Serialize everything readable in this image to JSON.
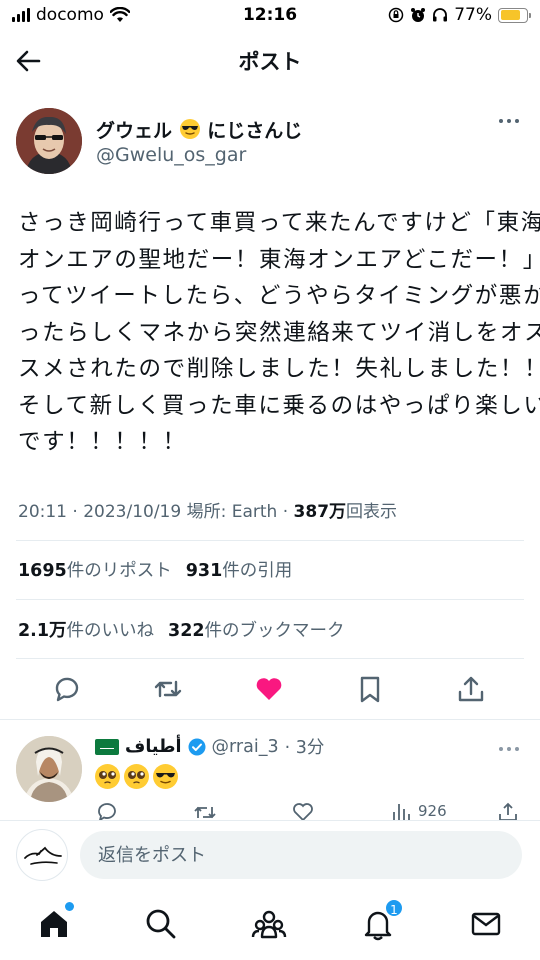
{
  "status_bar": {
    "carrier": "docomo",
    "time": "12:16",
    "battery": "77%",
    "battery_level": 0.77,
    "colors": {
      "battery_fill": "#f7c429"
    }
  },
  "header": {
    "title": "ポスト",
    "back_icon": "arrow-left-icon"
  },
  "tweet": {
    "author_name": "グウェル",
    "author_name_suffix": "にじさんじ",
    "author_handle": "@Gwelu_os_gar",
    "text_lines": [
      "さっき岡崎行って車買って来たんですけど「東海",
      "オンエアの聖地だー！東海オンエアどこだー！」",
      "ってツイートしたら、どうやらタイミングが悪か",
      "ったらしくマネから突然連絡来てツイ消しをオス",
      "スメされたので削除しました！失礼しました！！",
      "そして新しく買った車に乗るのはやっぱり楽しい",
      "です！！！！！"
    ],
    "meta_prefix": "20:11 · 2023/10/19 場所: Earth · ",
    "views_count": "387万",
    "views_label": "回表示",
    "reposts_count": "1695",
    "reposts_label": "件のリポスト",
    "quotes_count": "931",
    "quotes_label": "件の引用",
    "likes_count": "2.1万",
    "likes_label": "件のいいね",
    "bookmarks_count": "322",
    "bookmarks_label": "件のブックマーク",
    "liked": true,
    "colors": {
      "like_active": "#f91880"
    }
  },
  "reply": {
    "name": "أطياف",
    "handle": "@rrai_3",
    "time_ago": "· 3分",
    "emojis": [
      "pleading-face",
      "pleading-face",
      "sunglasses-face"
    ],
    "views": "926"
  },
  "compose": {
    "placeholder": "返信をポスト"
  },
  "tab_bar": {
    "items": [
      "home-icon",
      "search-icon",
      "communities-icon",
      "notifications-icon",
      "messages-icon"
    ],
    "notification_badge": "1",
    "colors": {
      "badge": "#1d9bf0"
    }
  }
}
